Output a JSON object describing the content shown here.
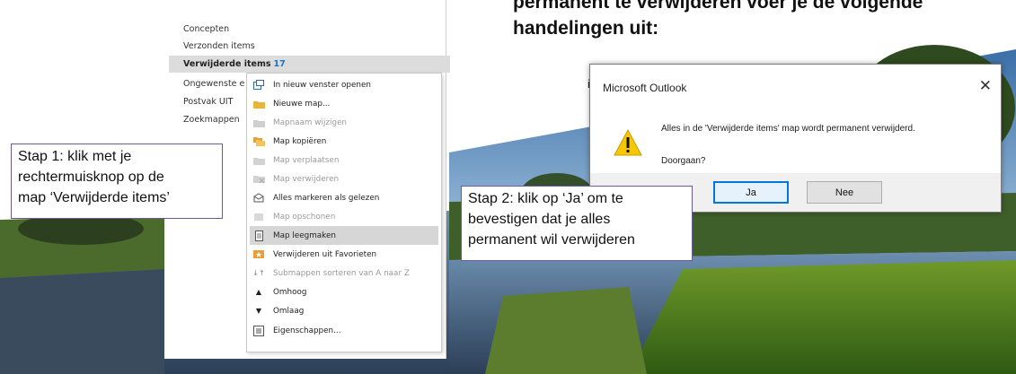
{
  "heading": {
    "line1": "permanent te verwijderen voer je de volgende",
    "line2": "handelingen uit:"
  },
  "folders": {
    "concepten": "Concepten",
    "verzonden": "Verzonden items",
    "verwijderd": "Verwijderde items",
    "verwijderd_count": "17",
    "ongewenst": "Ongewenste e",
    "postvak_uit": "Postvak UIT",
    "zoekmappen": "Zoekmappen"
  },
  "context_menu": {
    "items": [
      {
        "label": "In nieuw venster openen",
        "icon": "new-window-icon",
        "enabled": true
      },
      {
        "label": "Nieuwe map...",
        "icon": "new-folder-icon",
        "enabled": true
      },
      {
        "label": "Mapnaam wijzigen",
        "icon": "rename-folder-icon",
        "enabled": false
      },
      {
        "label": "Map kopiëren",
        "icon": "copy-folder-icon",
        "enabled": true
      },
      {
        "label": "Map verplaatsen",
        "icon": "move-folder-icon",
        "enabled": false
      },
      {
        "label": "Map verwijderen",
        "icon": "delete-folder-icon",
        "enabled": false
      },
      {
        "label": "Alles markeren als gelezen",
        "icon": "mark-read-icon",
        "enabled": true
      },
      {
        "label": "Map opschonen",
        "icon": "clean-folder-icon",
        "enabled": false
      },
      {
        "label": "Map leegmaken",
        "icon": "empty-folder-icon",
        "enabled": true,
        "highlighted": true
      },
      {
        "label": "Verwijderen uit Favorieten",
        "icon": "remove-favorites-icon",
        "enabled": true
      },
      {
        "label": "Submappen sorteren van A naar Z",
        "icon": "sort-az-icon",
        "enabled": false
      },
      {
        "label": "Omhoog",
        "icon": "arrow-up-icon",
        "enabled": true
      },
      {
        "label": "Omlaag",
        "icon": "arrow-down-icon",
        "enabled": true
      },
      {
        "label": "Eigenschappen...",
        "icon": "properties-icon",
        "enabled": true
      }
    ]
  },
  "callout1": {
    "line1": "Stap 1: klik met je",
    "line2": "rechtermuisknop op de",
    "line3": "map ‘Verwijderde items’"
  },
  "callout2": {
    "line1": "Stap 2: klik op ‘Ja’ om te",
    "line2": "bevestigen dat je alles",
    "line3": "permanent wil verwijderen"
  },
  "dialog": {
    "title": "Microsoft Outlook",
    "close_glyph": "✕",
    "message": "Alles in de 'Verwijderde items' map wordt permanent verwijderd.",
    "question": "Doorgaan?",
    "yes_label": "Ja",
    "no_label": "Nee",
    "peek_text": "it"
  },
  "colors": {
    "accent_blue": "#0078d7",
    "count_blue": "#1f6fd1",
    "callout_border": "#6a5a9a",
    "menu_highlight": "#d6d6d6",
    "warning_yellow": "#f7c800"
  }
}
